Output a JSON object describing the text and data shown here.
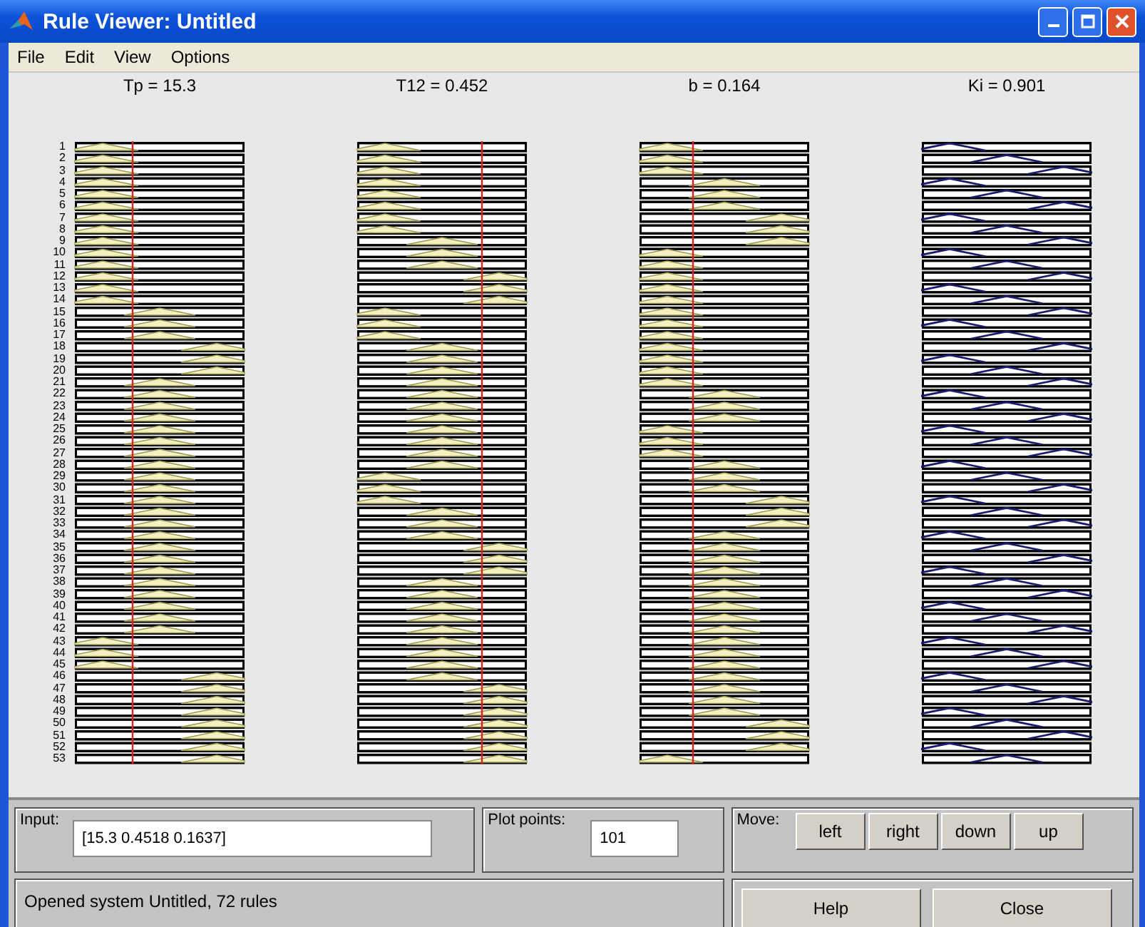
{
  "window": {
    "title": "Rule Viewer: Untitled"
  },
  "menu": [
    "File",
    "Edit",
    "View",
    "Options"
  ],
  "rule_numbers": [
    "1",
    "2",
    "3",
    "4",
    "5",
    "6",
    "7",
    "8",
    "9",
    "10",
    "11",
    "12",
    "13",
    "14",
    "15",
    "16",
    "17",
    "18",
    "19",
    "20",
    "21",
    "22",
    "23",
    "24",
    "25",
    "26",
    "27",
    "28",
    "29",
    "30",
    "31",
    "32",
    "33",
    "34",
    "35",
    "36",
    "37",
    "38",
    "39",
    "40",
    "41",
    "42",
    "43",
    "44",
    "45",
    "46",
    "47",
    "48",
    "49",
    "50",
    "51",
    "52",
    "53"
  ],
  "variables": [
    {
      "label": "Tp = 15.3",
      "kind": "input"
    },
    {
      "label": "T12 = 0.452",
      "kind": "input"
    },
    {
      "label": "b = 0.164",
      "kind": "input"
    },
    {
      "label": "Ki = 0.901",
      "kind": "output"
    }
  ],
  "input": {
    "label": "Input:",
    "value": "[15.3 0.4518 0.1637]"
  },
  "plot_points": {
    "label": "Plot points:",
    "value": "101"
  },
  "move": {
    "label": "Move:",
    "buttons": [
      "left",
      "right",
      "down",
      "up"
    ]
  },
  "status": "Opened system Untitled, 72 rules",
  "buttons": [
    "Help",
    "Close"
  ]
}
